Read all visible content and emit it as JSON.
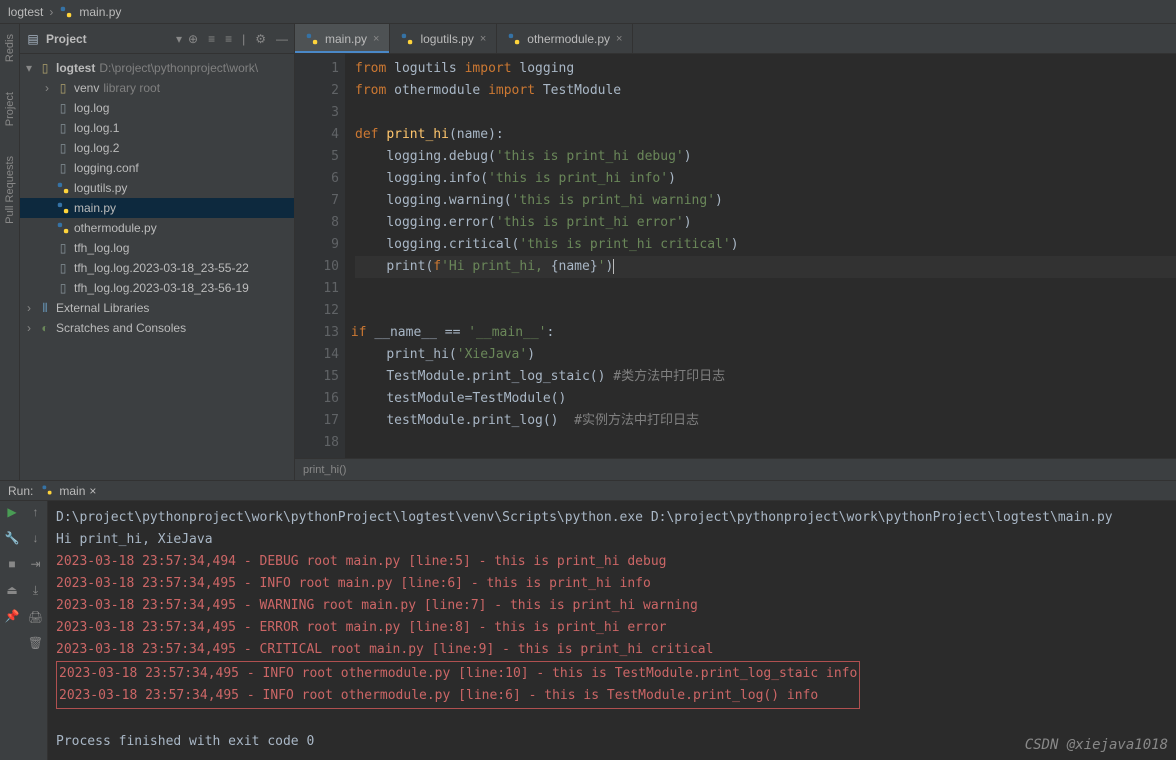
{
  "breadcrumb": {
    "root": "logtest",
    "file": "main.py"
  },
  "project": {
    "title": "Project",
    "root": {
      "name": "logtest",
      "path": "D:\\project\\pythonproject\\work\\"
    },
    "venv": {
      "name": "venv",
      "note": "library root"
    },
    "files": [
      {
        "name": "log.log",
        "icon": "file"
      },
      {
        "name": "log.log.1",
        "icon": "file"
      },
      {
        "name": "log.log.2",
        "icon": "file"
      },
      {
        "name": "logging.conf",
        "icon": "file"
      },
      {
        "name": "logutils.py",
        "icon": "py"
      },
      {
        "name": "main.py",
        "icon": "py",
        "selected": true
      },
      {
        "name": "othermodule.py",
        "icon": "py"
      },
      {
        "name": "tfh_log.log",
        "icon": "file"
      },
      {
        "name": "tfh_log.log.2023-03-18_23-55-22",
        "icon": "file"
      },
      {
        "name": "tfh_log.log.2023-03-18_23-56-19",
        "icon": "file"
      }
    ],
    "external": "External Libraries",
    "scratches": "Scratches and Consoles"
  },
  "tabs": [
    {
      "name": "main.py",
      "active": true
    },
    {
      "name": "logutils.py",
      "active": false
    },
    {
      "name": "othermodule.py",
      "active": false
    }
  ],
  "code": {
    "lines": [
      {
        "n": 1,
        "tokens": [
          [
            "kw",
            "from "
          ],
          [
            "op",
            "logutils "
          ],
          [
            "kw",
            "import "
          ],
          [
            "op",
            "logging"
          ]
        ]
      },
      {
        "n": 2,
        "tokens": [
          [
            "kw",
            "from "
          ],
          [
            "op",
            "othermodule "
          ],
          [
            "kw",
            "import "
          ],
          [
            "op",
            "TestModule"
          ]
        ]
      },
      {
        "n": 3,
        "tokens": []
      },
      {
        "n": 4,
        "tokens": [
          [
            "kw",
            "def "
          ],
          [
            "fn",
            "print_hi"
          ],
          [
            "op",
            "(name):"
          ]
        ]
      },
      {
        "n": 5,
        "indent": 1,
        "tokens": [
          [
            "op",
            "logging.debug("
          ],
          [
            "str",
            "'this is print_hi debug'"
          ],
          [
            "op",
            ")"
          ]
        ]
      },
      {
        "n": 6,
        "indent": 1,
        "tokens": [
          [
            "op",
            "logging.info("
          ],
          [
            "str",
            "'this is print_hi info'"
          ],
          [
            "op",
            ")"
          ]
        ]
      },
      {
        "n": 7,
        "indent": 1,
        "tokens": [
          [
            "op",
            "logging.warning("
          ],
          [
            "str",
            "'this is print_hi warning'"
          ],
          [
            "op",
            ")"
          ]
        ]
      },
      {
        "n": 8,
        "indent": 1,
        "tokens": [
          [
            "op",
            "logging.error("
          ],
          [
            "str",
            "'this is print_hi error'"
          ],
          [
            "op",
            ")"
          ]
        ]
      },
      {
        "n": 9,
        "indent": 1,
        "tokens": [
          [
            "op",
            "logging.critical("
          ],
          [
            "str",
            "'this is print_hi critical'"
          ],
          [
            "op",
            ")"
          ]
        ]
      },
      {
        "n": 10,
        "indent": 1,
        "caret": true,
        "tokens": [
          [
            "op",
            "print("
          ],
          [
            "kw",
            "f"
          ],
          [
            "str",
            "'Hi print_hi, "
          ],
          [
            "op",
            "{name}"
          ],
          [
            "str",
            "'"
          ],
          [
            "op",
            ")"
          ]
        ]
      },
      {
        "n": 11,
        "tokens": []
      },
      {
        "n": 12,
        "tokens": []
      },
      {
        "n": 13,
        "play": true,
        "tokens": [
          [
            "kw",
            "if "
          ],
          [
            "op",
            "__name__ == "
          ],
          [
            "str",
            "'__main__'"
          ],
          [
            "op",
            ":"
          ]
        ]
      },
      {
        "n": 14,
        "indent": 1,
        "tokens": [
          [
            "op",
            "print_hi("
          ],
          [
            "str",
            "'XieJava'"
          ],
          [
            "op",
            ")"
          ]
        ]
      },
      {
        "n": 15,
        "indent": 1,
        "tokens": [
          [
            "op",
            "TestModule.print_log_staic() "
          ],
          [
            "com",
            "#类方法中打印日志"
          ]
        ]
      },
      {
        "n": 16,
        "indent": 1,
        "tokens": [
          [
            "op",
            "testModule=TestModule()"
          ]
        ]
      },
      {
        "n": 17,
        "indent": 1,
        "tokens": [
          [
            "op",
            "testModule.print_log()  "
          ],
          [
            "com",
            "#实例方法中打印日志"
          ]
        ]
      },
      {
        "n": 18,
        "tokens": []
      }
    ],
    "context": "print_hi()"
  },
  "run": {
    "label": "Run:",
    "tab": "main",
    "lines": [
      {
        "cls": "",
        "text": "D:\\project\\pythonproject\\work\\pythonProject\\logtest\\venv\\Scripts\\python.exe D:\\project\\pythonproject\\work\\pythonProject\\logtest\\main.py"
      },
      {
        "cls": "",
        "text": "Hi print_hi, XieJava"
      },
      {
        "cls": "red",
        "text": "2023-03-18 23:57:34,494 - DEBUG root main.py [line:5] - this is print_hi debug"
      },
      {
        "cls": "red",
        "text": "2023-03-18 23:57:34,495 - INFO root main.py [line:6] - this is print_hi info"
      },
      {
        "cls": "red",
        "text": "2023-03-18 23:57:34,495 - WARNING root main.py [line:7] - this is print_hi warning"
      },
      {
        "cls": "red",
        "text": "2023-03-18 23:57:34,495 - ERROR root main.py [line:8] - this is print_hi error"
      },
      {
        "cls": "red",
        "text": "2023-03-18 23:57:34,495 - CRITICAL root main.py [line:9] - this is print_hi critical"
      },
      {
        "cls": "red box",
        "text": "2023-03-18 23:57:34,495 - INFO root othermodule.py [line:10] - this is TestModule.print_log_staic info"
      },
      {
        "cls": "red box",
        "text": "2023-03-18 23:57:34,495 - INFO root othermodule.py [line:6] - this is TestModule.print_log() info"
      },
      {
        "cls": "",
        "text": ""
      },
      {
        "cls": "",
        "text": "Process finished with exit code 0"
      }
    ]
  },
  "sidebars": {
    "left": [
      "Redis",
      "Project",
      "Pull Requests"
    ]
  },
  "watermark": "CSDN @xiejava1018"
}
